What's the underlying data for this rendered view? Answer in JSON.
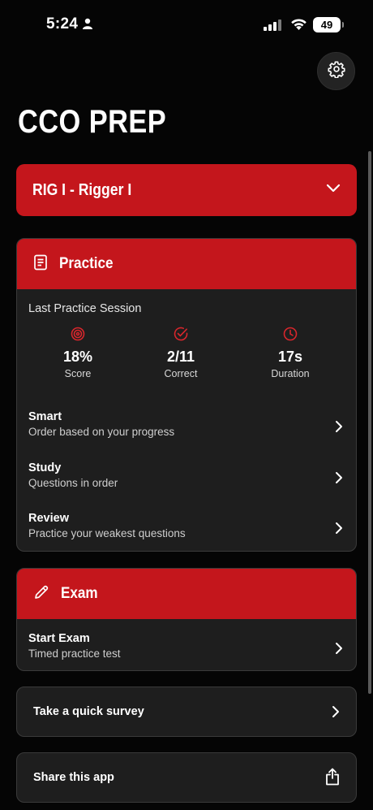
{
  "status_bar": {
    "time": "5:24",
    "battery": "49"
  },
  "header": {
    "title": "CCO PREP"
  },
  "certification_select": {
    "label": "RIG I - Rigger I"
  },
  "practice": {
    "title": "Practice",
    "last_session_label": "Last Practice Session",
    "stats": {
      "score": {
        "value": "18%",
        "label": "Score"
      },
      "correct": {
        "value": "2/11",
        "label": "Correct"
      },
      "duration": {
        "value": "17s",
        "label": "Duration"
      }
    },
    "modes": [
      {
        "title": "Smart",
        "subtitle": "Order based on your progress"
      },
      {
        "title": "Study",
        "subtitle": "Questions in order"
      },
      {
        "title": "Review",
        "subtitle": "Practice your weakest questions"
      }
    ]
  },
  "exam": {
    "title": "Exam",
    "start": {
      "title": "Start Exam",
      "subtitle": "Timed practice test"
    }
  },
  "links": {
    "survey": "Take a quick survey",
    "share": "Share this app"
  },
  "colors": {
    "accent": "#c4161c",
    "card": "#1e1e1e",
    "background": "#050505"
  }
}
